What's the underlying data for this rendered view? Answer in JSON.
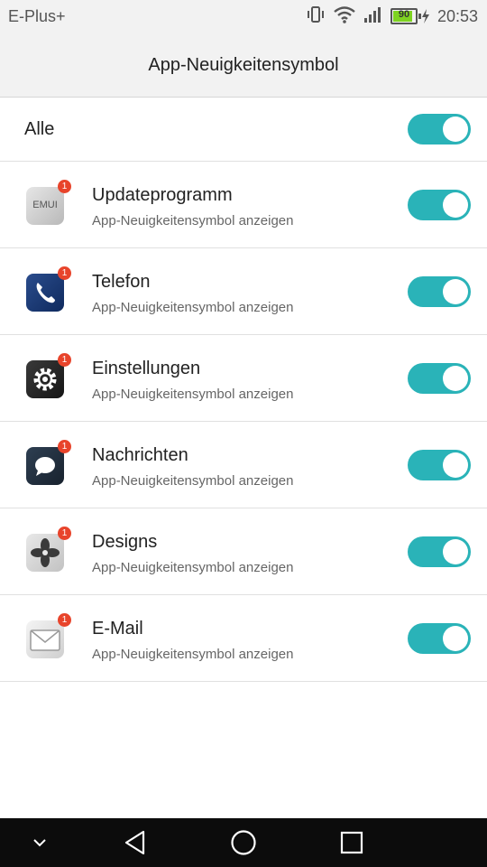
{
  "status_bar": {
    "carrier": "E-Plus+",
    "battery_level": "90",
    "time": "20:53"
  },
  "header": {
    "title": "App-Neuigkeitensymbol"
  },
  "all_row": {
    "label": "Alle",
    "enabled": true
  },
  "apps": [
    {
      "name": "Updateprogramm",
      "subtitle": "App-Neuigkeitensymbol anzeigen",
      "badge": "1",
      "icon": "emui-updater-icon",
      "icon_text": "EMUI",
      "enabled": true
    },
    {
      "name": "Telefon",
      "subtitle": "App-Neuigkeitensymbol anzeigen",
      "badge": "1",
      "icon": "phone-icon",
      "enabled": true
    },
    {
      "name": "Einstellungen",
      "subtitle": "App-Neuigkeitensymbol anzeigen",
      "badge": "1",
      "icon": "settings-gear-icon",
      "enabled": true
    },
    {
      "name": "Nachrichten",
      "subtitle": "App-Neuigkeitensymbol anzeigen",
      "badge": "1",
      "icon": "messages-icon",
      "enabled": true
    },
    {
      "name": "Designs",
      "subtitle": "App-Neuigkeitensymbol anzeigen",
      "badge": "1",
      "icon": "themes-icon",
      "enabled": true
    },
    {
      "name": "E-Mail",
      "subtitle": "App-Neuigkeitensymbol anzeigen",
      "badge": "1",
      "icon": "email-icon",
      "enabled": true
    }
  ],
  "colors": {
    "accent": "#2ab3b8",
    "badge": "#e8442b",
    "battery": "#7ed321"
  },
  "nav_bar": {
    "icons": [
      "chevron-down-icon",
      "back-icon",
      "home-icon",
      "recents-icon"
    ]
  }
}
